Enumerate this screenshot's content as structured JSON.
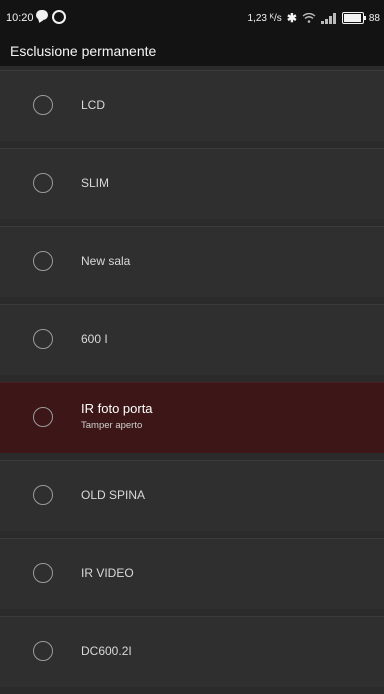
{
  "status_bar": {
    "time": "10:20",
    "speed": "1,23 ᴷ/s",
    "battery": "88"
  },
  "header": {
    "title": "Esclusione permanente"
  },
  "items": [
    {
      "label": "LCD",
      "sub": ""
    },
    {
      "label": "SLIM",
      "sub": ""
    },
    {
      "label": "New sala",
      "sub": ""
    },
    {
      "label": "600 I",
      "sub": ""
    },
    {
      "label": "IR foto porta",
      "sub": "Tamper aperto",
      "alert": true
    },
    {
      "label": "OLD SPINA",
      "sub": ""
    },
    {
      "label": "IR VIDEO",
      "sub": ""
    },
    {
      "label": "DC600.2I",
      "sub": ""
    }
  ],
  "colors": {
    "background": "#2b2b2b",
    "bar": "#131313",
    "alert_row": "#3d1717"
  }
}
